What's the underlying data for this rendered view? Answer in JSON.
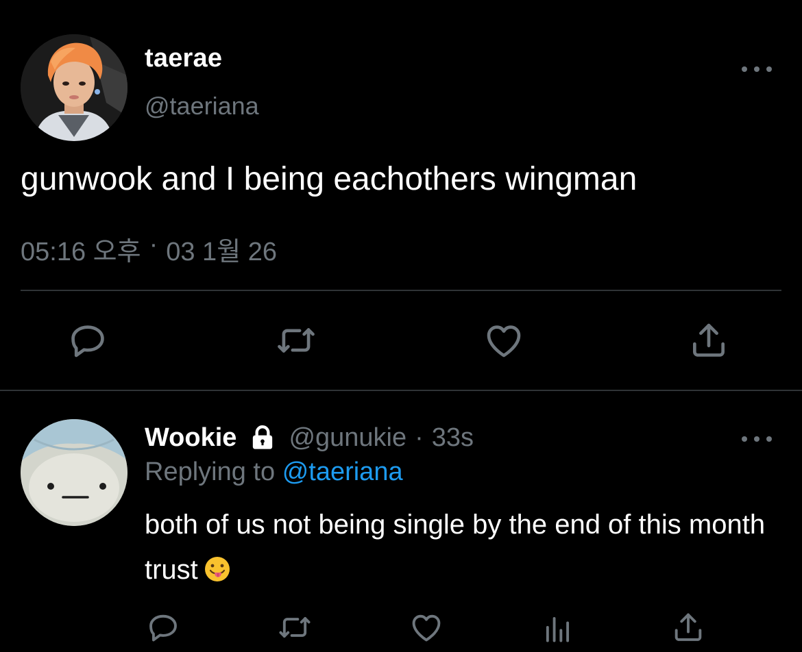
{
  "tweet": {
    "display_name": "taerae",
    "handle": "@taeriana",
    "text": "gunwook and I being eachothers wingman",
    "time": "05:16 오후",
    "separator": "·",
    "date": "03 1월 26"
  },
  "tweet_actions": [
    "reply-icon",
    "retweet-icon",
    "like-icon",
    "share-icon"
  ],
  "reply": {
    "display_name": "Wookie",
    "protected_icon": "lock-icon",
    "handle": "@gunukie",
    "separator": "·",
    "age": "33s",
    "replying_prefix": "Replying to",
    "replying_mention": "@taeriana",
    "text": "both of us not being single by the end of this month trust",
    "emoji": "tongue-out-face-emoji"
  },
  "reply_actions": [
    "reply-icon",
    "retweet-icon",
    "like-icon",
    "analytics-icon",
    "share-icon"
  ],
  "colors": {
    "background": "#000000",
    "primary_text": "#ffffff",
    "secondary_text": "#6e767d",
    "link": "#1d9bf0",
    "divider": "#2f3336"
  }
}
